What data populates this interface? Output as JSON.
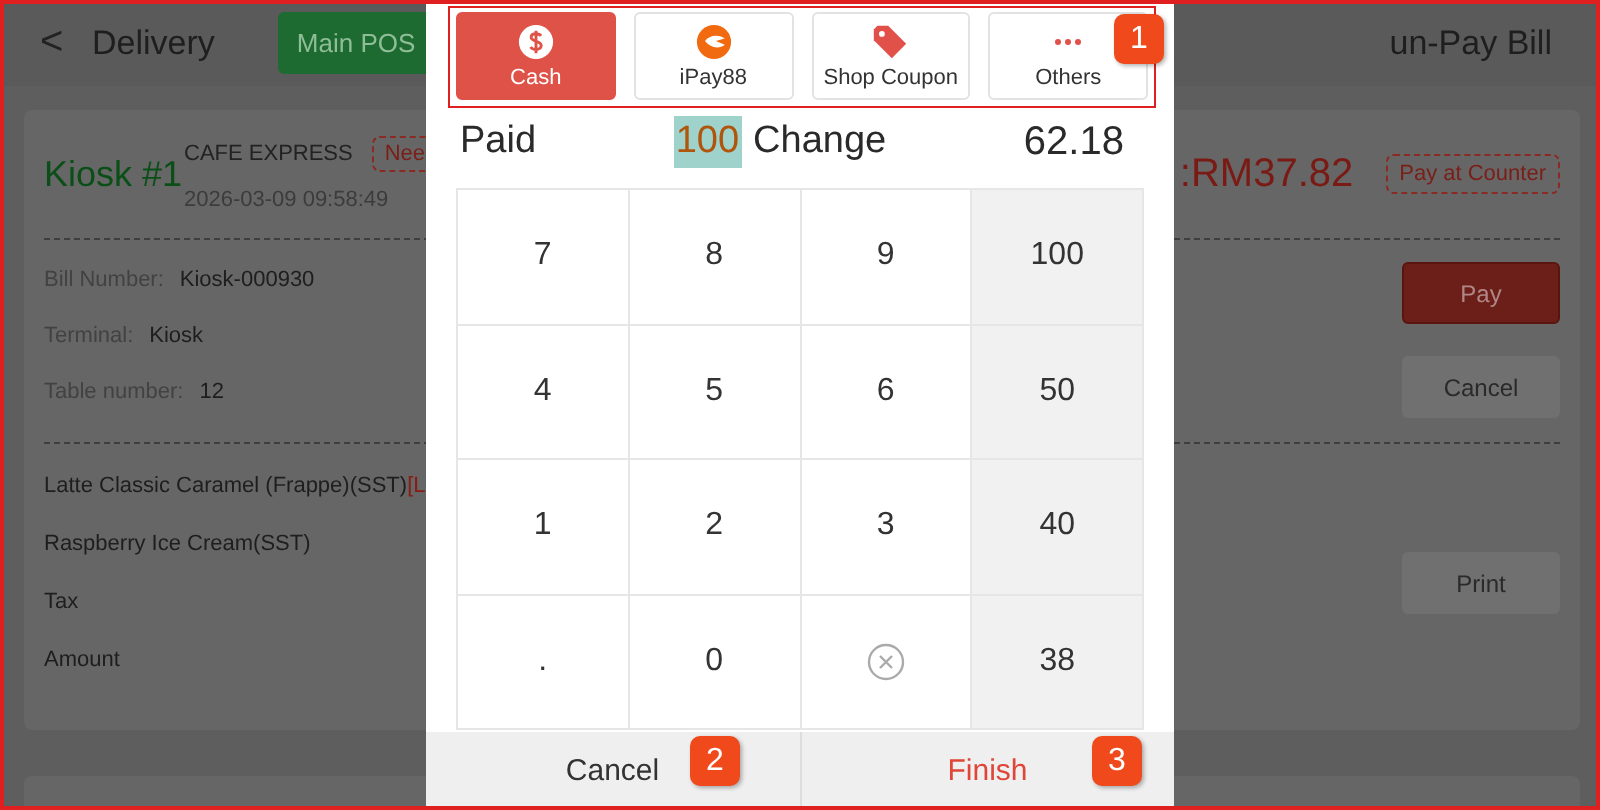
{
  "header": {
    "back": "<",
    "title": "Delivery",
    "main_pos": "Main POS",
    "right_title": "un-Pay Bill"
  },
  "order": {
    "name": "Kiosk #1",
    "store": "CAFE EXPRESS",
    "status_badge": "Nee",
    "time": "2026-03-09 09:58:49",
    "total": ":RM37.82",
    "payment_badge": "Pay at Counter",
    "details": [
      {
        "label": "Bill Number:",
        "value": "Kiosk-000930"
      },
      {
        "label": "Terminal:",
        "value": "Kiosk"
      },
      {
        "label": "Table number:",
        "value": "12"
      }
    ],
    "items": [
      {
        "name": "Latte Classic Caramel (Frappe)(SST)",
        "note": "[L"
      },
      {
        "name": "Raspberry Ice Cream(SST)"
      },
      {
        "name": "Tax"
      },
      {
        "name": "Amount"
      }
    ],
    "buttons": [
      "Pay",
      "Cancel",
      "Print"
    ]
  },
  "payment_dialog": {
    "tabs": [
      {
        "label": "Cash",
        "selected": true
      },
      {
        "label": "iPay88",
        "selected": false
      },
      {
        "label": "Shop Coupon",
        "selected": false
      },
      {
        "label": "Others",
        "selected": false
      }
    ],
    "paid_label": "Paid",
    "paid_value": "100",
    "change_label": "Change",
    "change_value": "62.18",
    "keys": [
      {
        "kind": "digit",
        "label": "7"
      },
      {
        "kind": "digit",
        "label": "8"
      },
      {
        "kind": "digit",
        "label": "9"
      },
      {
        "kind": "amount",
        "label": "100"
      },
      {
        "kind": "digit",
        "label": "4"
      },
      {
        "kind": "digit",
        "label": "5"
      },
      {
        "kind": "digit",
        "label": "6"
      },
      {
        "kind": "amount",
        "label": "50"
      },
      {
        "kind": "digit",
        "label": "1"
      },
      {
        "kind": "digit",
        "label": "2"
      },
      {
        "kind": "digit",
        "label": "3"
      },
      {
        "kind": "amount",
        "label": "40"
      },
      {
        "kind": "digit",
        "label": "."
      },
      {
        "kind": "digit",
        "label": "0"
      },
      {
        "kind": "clear"
      },
      {
        "kind": "amount",
        "label": "38"
      }
    ],
    "cancel": "Cancel",
    "finish": "Finish"
  },
  "annotations": [
    "1",
    "2",
    "3"
  ]
}
